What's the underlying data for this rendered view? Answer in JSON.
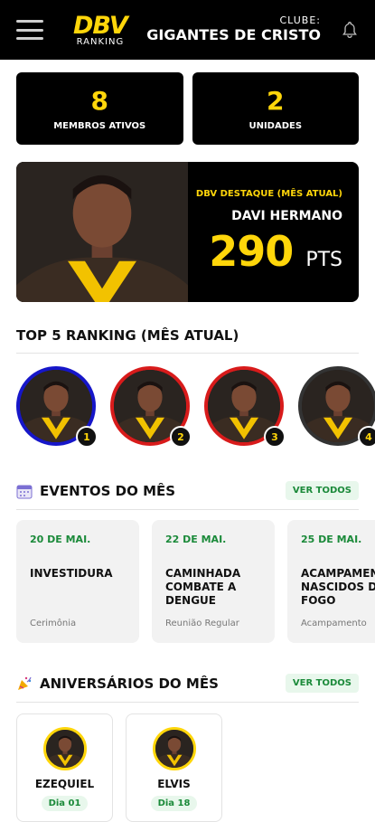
{
  "header": {
    "logo_main": "DBV",
    "logo_sub": "RANKING",
    "club_label": "CLUBE:",
    "club_name": "GIGANTES DE CRISTO"
  },
  "stats": [
    {
      "value": "8",
      "label": "MEMBROS ATIVOS"
    },
    {
      "value": "2",
      "label": "UNIDADES"
    }
  ],
  "destaque": {
    "tag": "DBV DESTAQUE (MÊS ATUAL)",
    "name": "DAVI HERMANO",
    "points": "290",
    "points_unit": "PTS"
  },
  "ranking": {
    "title": "TOP 5 RANKING (MÊS ATUAL)",
    "items": [
      {
        "position": "1",
        "ring_color": "#1616c9"
      },
      {
        "position": "2",
        "ring_color": "#d81b1b"
      },
      {
        "position": "3",
        "ring_color": "#d81b1b"
      },
      {
        "position": "4",
        "ring_color": "#333333"
      }
    ]
  },
  "events": {
    "title": "EVENTOS DO MÊS",
    "see_all": "VER TODOS",
    "items": [
      {
        "date": "20 DE MAI.",
        "title": "INVESTIDURA",
        "type": "Cerimônia"
      },
      {
        "date": "22 DE MAI.",
        "title": "CAMINHADA COMBATE A DENGUE",
        "type": "Reunião Regular"
      },
      {
        "date": "25 DE MAI.",
        "title": "ACAMPAMENTO NASCIDOS DO FOGO",
        "type": "Acampamento"
      }
    ]
  },
  "birthdays": {
    "title": "ANIVERSÁRIOS DO MÊS",
    "see_all": "VER TODOS",
    "items": [
      {
        "name": "EZEQUIEL",
        "day": "Dia 01"
      },
      {
        "name": "ELVIS",
        "day": "Dia 18"
      }
    ]
  },
  "colors": {
    "accent_yellow": "#FFD60A",
    "accent_green": "#1b8a3a",
    "background_dark": "#000000"
  },
  "icons": {
    "menu": "hamburger-icon",
    "notifications": "bell-icon",
    "events": "calendar-icon",
    "birthdays": "party-popper-icon"
  }
}
